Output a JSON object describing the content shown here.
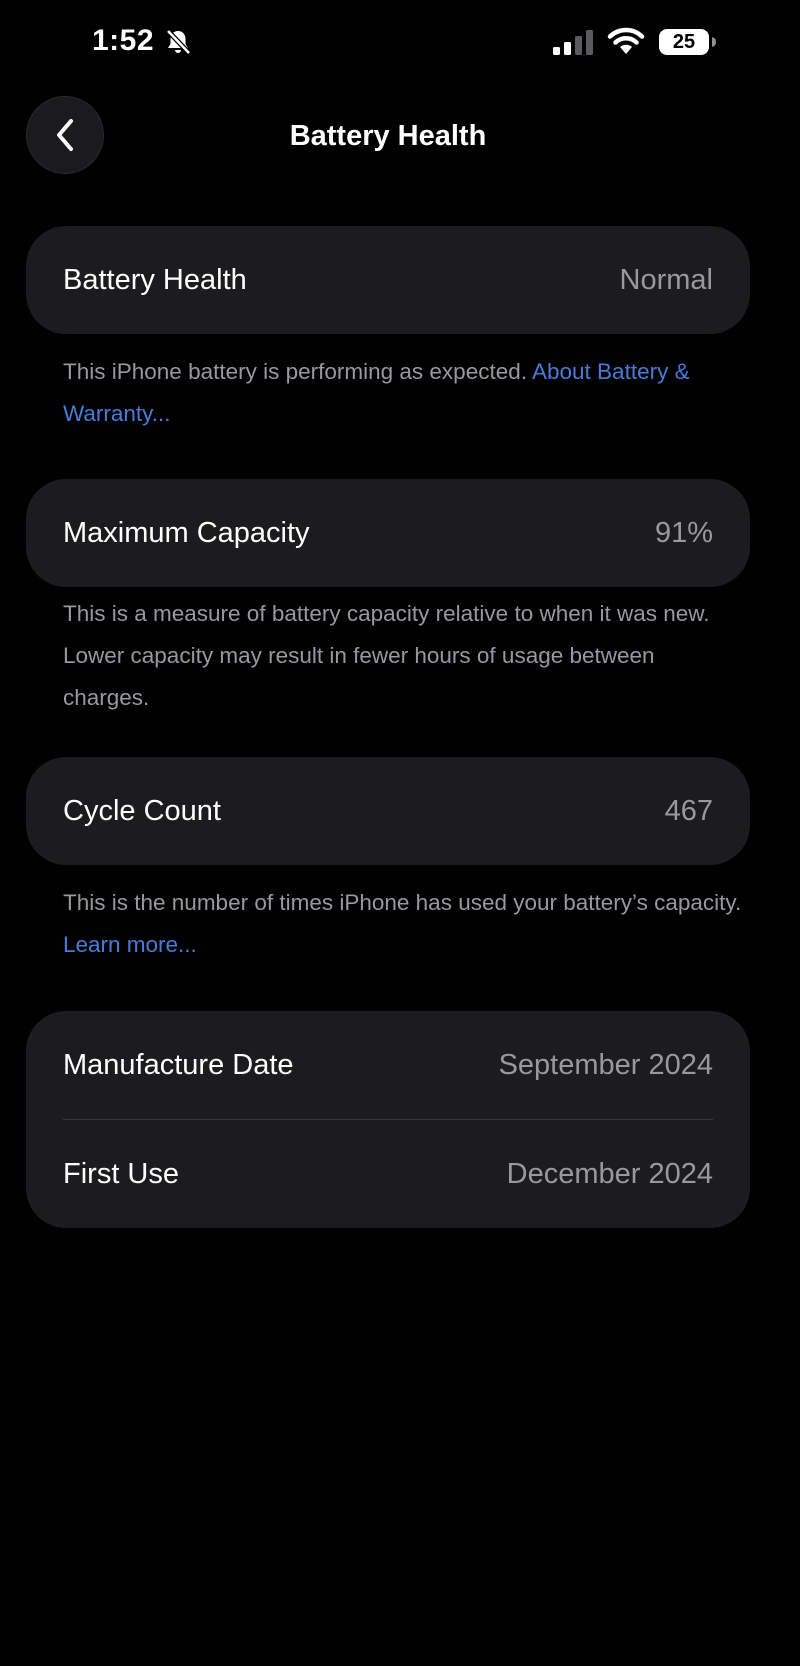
{
  "status_bar": {
    "time": "1:52",
    "battery_level": "25"
  },
  "nav": {
    "title": "Battery Health"
  },
  "battery_health": {
    "label": "Battery Health",
    "value": "Normal",
    "footnote_text": "This iPhone battery is performing as expected. ",
    "footnote_link": "About Battery & Warranty..."
  },
  "maximum_capacity": {
    "label": "Maximum Capacity",
    "value": "91%",
    "footnote_text": "This is a measure of battery capacity relative to when it was new. Lower capacity may result in fewer hours of usage between charges."
  },
  "cycle_count": {
    "label": "Cycle Count",
    "value": "467",
    "footnote_text": "This is the number of times iPhone has used your battery’s capacity. ",
    "footnote_link": "Learn more..."
  },
  "dates": {
    "manufacture_label": "Manufacture Date",
    "manufacture_value": "September 2024",
    "first_use_label": "First Use",
    "first_use_value": "December 2024"
  },
  "colors": {
    "background": "#000000",
    "card": "#1c1c1e",
    "secondary_text": "#98989e",
    "link": "#4a7bd8"
  }
}
